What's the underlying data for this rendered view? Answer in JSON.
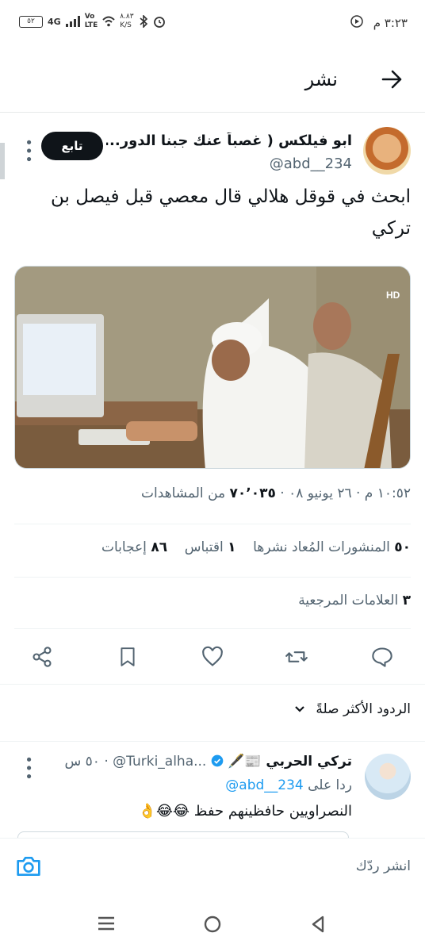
{
  "status_bar": {
    "time": "٣:٢٣ م",
    "battery": "٥٢",
    "network": "4G",
    "volte_top": "Vo",
    "volte_bottom": "LTE",
    "speed_top": "٨.٨٣",
    "speed_bottom": "K/S"
  },
  "header": {
    "title": "نشر"
  },
  "tweet": {
    "display_name": "ابو فيلكس ( غصباً عنك جبنا الدور...",
    "handle": "@abd__234",
    "follow_label": "تابع",
    "text": "ابحث في قوقل هلالي قال معصي قبل فيصل بن تركي",
    "timestamp": "١٠:٥٢ م · ٢٦ يونيو ٠٨",
    "views_count": "٧٠٬٠٣٥",
    "views_label": "من المشاهدات",
    "reposts_count": "٥٠",
    "reposts_label": "المنشورات المُعاد نشرها",
    "quotes_count": "١",
    "quotes_label": "اقتباس",
    "likes_count": "٨٦",
    "likes_label": "إعجابات",
    "bookmarks_count": "٣",
    "bookmarks_label": "العلامات المرجعية",
    "media_watermark": "HD"
  },
  "sort": {
    "label": "الردود الأكثر صلةً"
  },
  "reply": {
    "name": "تركي الحربي 📰🖋️",
    "handle": "@Turki_alha...",
    "time": "٥٠ س",
    "reply_to_prefix": "ردا على",
    "reply_to_handle": "@abd__234",
    "text": "النصراويين حافظينهم حفظ 😂😂👌"
  },
  "compose": {
    "placeholder": "انشر ردّك"
  },
  "colors": {
    "accent": "#1d9bf0",
    "text": "#0f1419",
    "muted": "#536471"
  }
}
